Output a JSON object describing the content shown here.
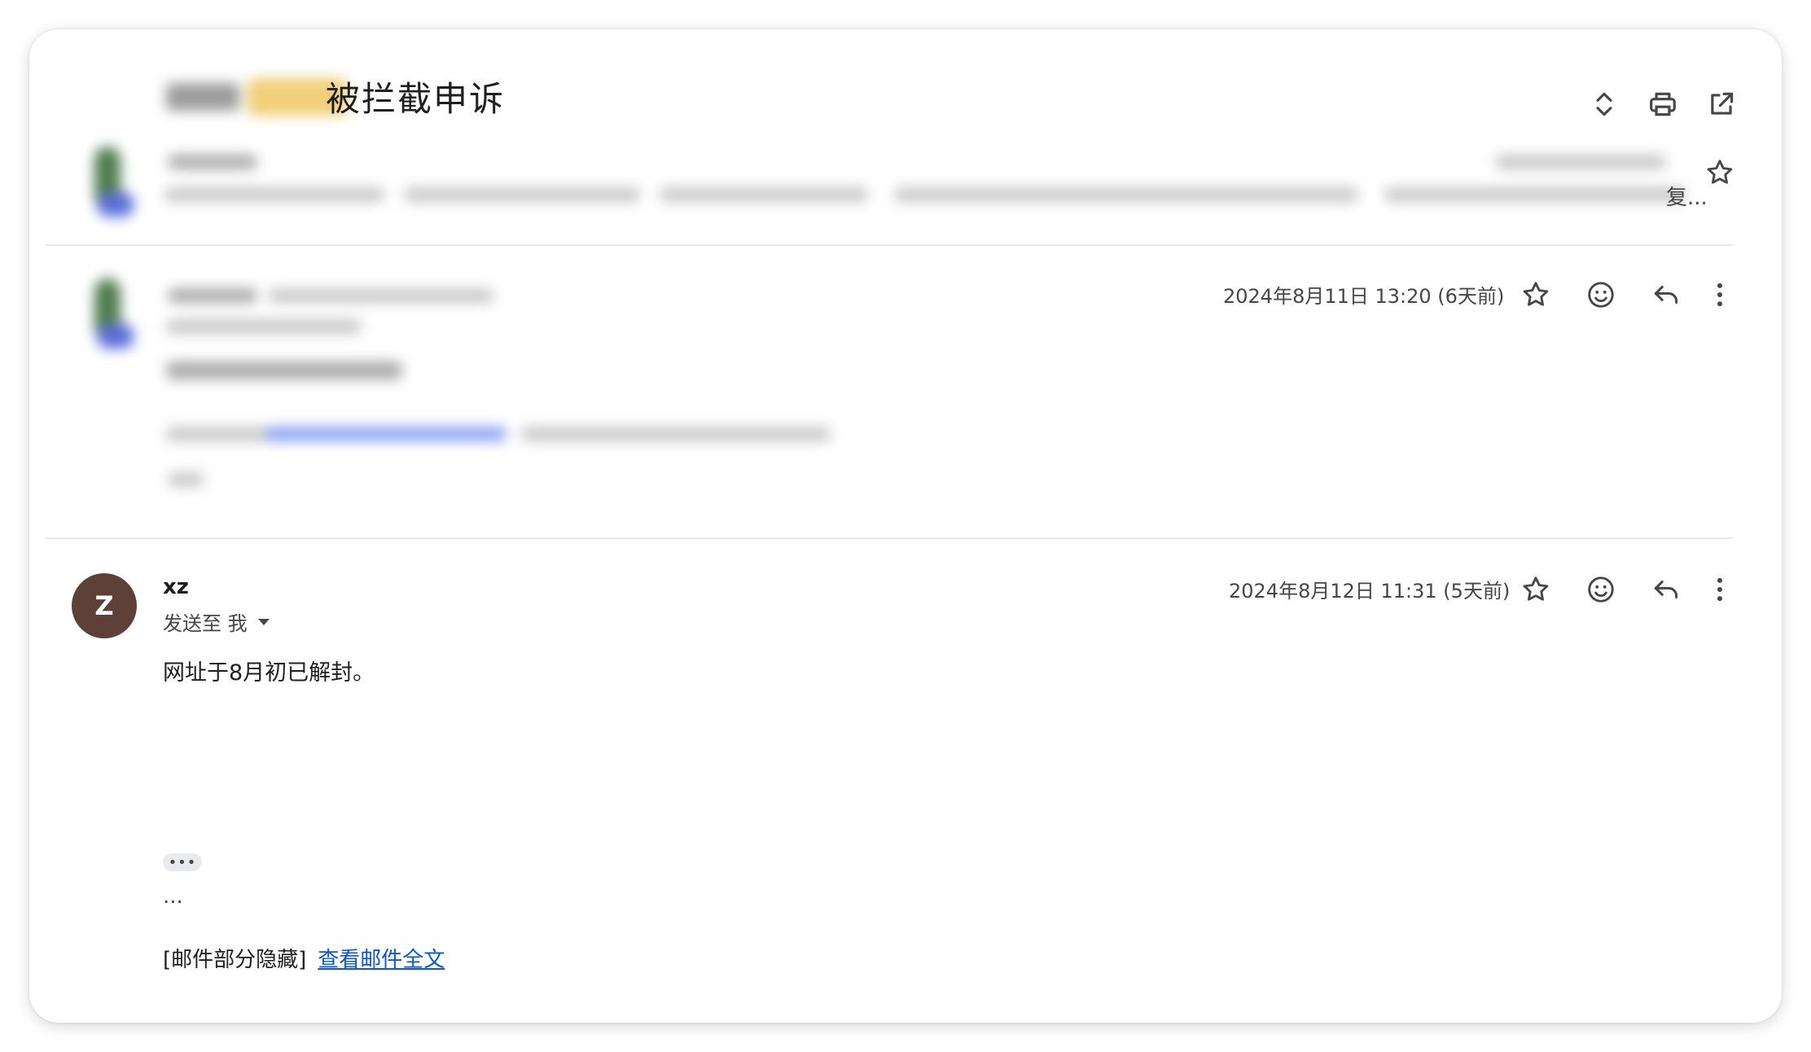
{
  "thread": {
    "subject": "被拦截申诉"
  },
  "toolbar": {
    "expand_icon": "unfold-icon",
    "print_icon": "print-icon",
    "new_window_icon": "open-in-new-icon"
  },
  "collapsed_message": {
    "snippet_end": "复..."
  },
  "message_1": {
    "time": "2024年8月11日 13:20 (6天前)"
  },
  "message_2": {
    "avatar_letter": "Z",
    "avatar_color": "#5d4037",
    "sender": "xz",
    "to_label": "发送至 我",
    "time": "2024年8月12日 11:31 (5天前)",
    "body": "网址于8月初已解封。",
    "ellipsis_label": "•••",
    "dots": "...",
    "hidden_note": "[邮件部分隐藏]",
    "view_full_link": "查看邮件全文"
  },
  "colors": {
    "link": "#0b57d0",
    "text": "#1f1f1f",
    "secondary": "#444746",
    "divider": "#e6e6e6"
  }
}
